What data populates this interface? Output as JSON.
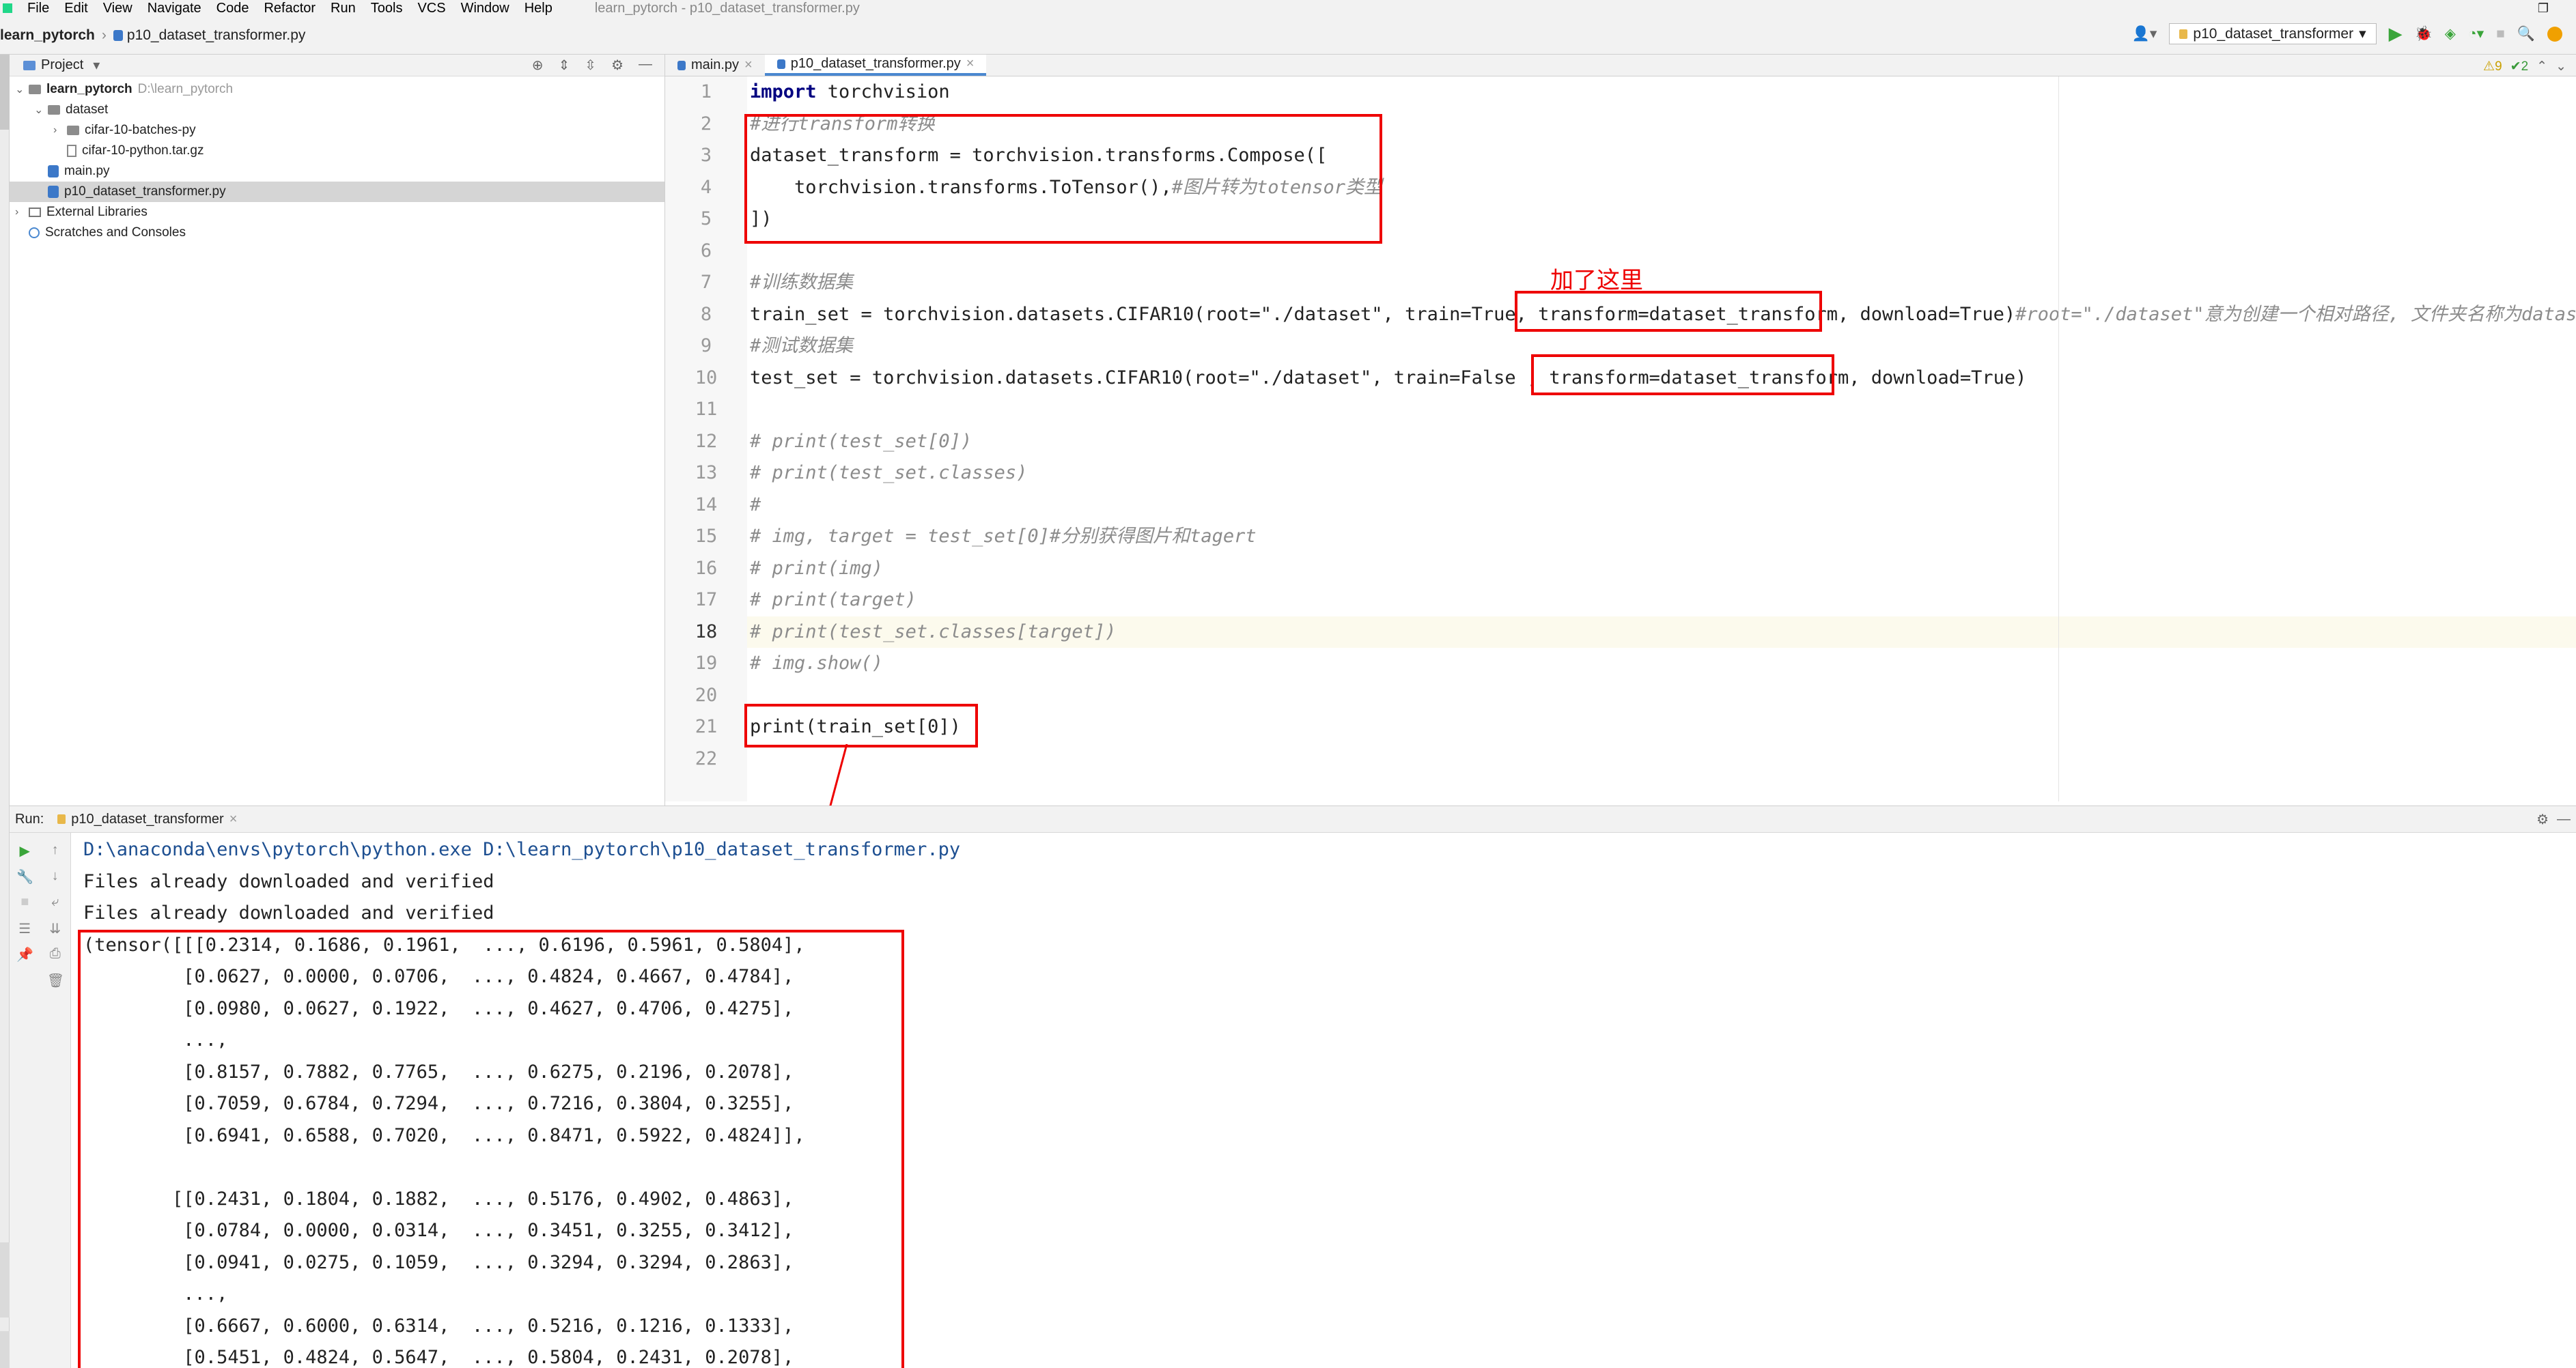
{
  "menubar": {
    "items": [
      "File",
      "Edit",
      "View",
      "Navigate",
      "Code",
      "Refactor",
      "Run",
      "Tools",
      "VCS",
      "Window",
      "Help"
    ],
    "title": "learn_pytorch - p10_dataset_transformer.py"
  },
  "navbar": {
    "project": "learn_pytorch",
    "file": "p10_dataset_transformer.py",
    "run_config": "p10_dataset_transformer",
    "warnings": "⚠9",
    "checks": "✔2"
  },
  "project_panel": {
    "title": "Project",
    "root_name": "learn_pytorch",
    "root_path": "D:\\learn_pytorch",
    "items": [
      {
        "label": "dataset"
      },
      {
        "label": "cifar-10-batches-py"
      },
      {
        "label": "cifar-10-python.tar.gz"
      },
      {
        "label": "main.py"
      },
      {
        "label": "p10_dataset_transformer.py"
      },
      {
        "label": "External Libraries"
      },
      {
        "label": "Scratches and Consoles"
      }
    ]
  },
  "editor": {
    "tabs": [
      {
        "label": "main.py"
      },
      {
        "label": "p10_dataset_transformer.py"
      }
    ],
    "annotation": "加了这里",
    "lines": [
      {
        "n": "1",
        "a": "import",
        "b": " torchvision",
        "c": "",
        "d": "",
        "e": ""
      },
      {
        "n": "2",
        "a": "",
        "b": "",
        "c": "#进行transform转换",
        "d": "",
        "e": ""
      },
      {
        "n": "3",
        "a": "",
        "b": "dataset_transform = torchvision.transforms.Compose([",
        "c": "",
        "d": "",
        "e": ""
      },
      {
        "n": "4",
        "a": "",
        "b": "    torchvision.transforms.ToTensor(),",
        "c": "#图片转为totensor类型",
        "d": "",
        "e": ""
      },
      {
        "n": "5",
        "a": "",
        "b": "])",
        "c": "",
        "d": "",
        "e": ""
      },
      {
        "n": "6",
        "a": "",
        "b": "",
        "c": "",
        "d": "",
        "e": ""
      },
      {
        "n": "7",
        "a": "",
        "b": "",
        "c": "#训练数据集",
        "d": "",
        "e": ""
      },
      {
        "n": "8",
        "a": "",
        "b": "train_set = torchvision.datasets.CIFAR10(root=\"./dataset\", train=True, transform=dataset_transform, download=True)",
        "c": "#root=\"./dataset\"意为创建一个相对路径, 文件夹名称为dataset",
        "d": "",
        "e": ""
      },
      {
        "n": "9",
        "a": "",
        "b": "",
        "c": "#测试数据集",
        "d": "",
        "e": ""
      },
      {
        "n": "10",
        "a": "",
        "b": "test_set = torchvision.datasets.CIFAR10(root=\"./dataset\", train=False , transform=dataset_transform, download=True)",
        "c": "",
        "d": "",
        "e": ""
      },
      {
        "n": "11",
        "a": "",
        "b": "",
        "c": "",
        "d": "",
        "e": ""
      },
      {
        "n": "12",
        "a": "",
        "b": "",
        "c": "# print(test_set[0])",
        "d": "",
        "e": ""
      },
      {
        "n": "13",
        "a": "",
        "b": "",
        "c": "# print(test_set.classes)",
        "d": "",
        "e": ""
      },
      {
        "n": "14",
        "a": "",
        "b": "",
        "c": "#",
        "d": "",
        "e": ""
      },
      {
        "n": "15",
        "a": "",
        "b": "",
        "c": "# img, target = test_set[0]#分别获得图片和tagert",
        "d": "",
        "e": ""
      },
      {
        "n": "16",
        "a": "",
        "b": "",
        "c": "# print(img)",
        "d": "",
        "e": ""
      },
      {
        "n": "17",
        "a": "",
        "b": "",
        "c": "# print(target)",
        "d": "",
        "e": ""
      },
      {
        "n": "18",
        "a": "",
        "b": "",
        "c": "# print(test_set.classes[target])",
        "d": "",
        "e": ""
      },
      {
        "n": "19",
        "a": "",
        "b": "",
        "c": "# img.show()",
        "d": "",
        "e": ""
      },
      {
        "n": "20",
        "a": "",
        "b": "",
        "c": "",
        "d": "",
        "e": ""
      },
      {
        "n": "21",
        "a": "",
        "b": "print(train_set[0])",
        "c": "",
        "d": "",
        "e": ""
      },
      {
        "n": "22",
        "a": "",
        "b": "",
        "c": "",
        "d": "",
        "e": ""
      }
    ]
  },
  "run": {
    "label": "Run:",
    "tab": "p10_dataset_transformer",
    "output": [
      "D:\\anaconda\\envs\\pytorch\\python.exe D:\\learn_pytorch\\p10_dataset_transformer.py",
      "Files already downloaded and verified",
      "Files already downloaded and verified",
      "(tensor([[[0.2314, 0.1686, 0.1961,  ..., 0.6196, 0.5961, 0.5804],",
      "         [0.0627, 0.0000, 0.0706,  ..., 0.4824, 0.4667, 0.4784],",
      "         [0.0980, 0.0627, 0.1922,  ..., 0.4627, 0.4706, 0.4275],",
      "         ...,",
      "         [0.8157, 0.7882, 0.7765,  ..., 0.6275, 0.2196, 0.2078],",
      "         [0.7059, 0.6784, 0.7294,  ..., 0.7216, 0.3804, 0.3255],",
      "         [0.6941, 0.6588, 0.7020,  ..., 0.8471, 0.5922, 0.4824]],",
      "",
      "        [[0.2431, 0.1804, 0.1882,  ..., 0.5176, 0.4902, 0.4863],",
      "         [0.0784, 0.0000, 0.0314,  ..., 0.3451, 0.3255, 0.3412],",
      "         [0.0941, 0.0275, 0.1059,  ..., 0.3294, 0.3294, 0.2863],",
      "         ...,",
      "         [0.6667, 0.6000, 0.6314,  ..., 0.5216, 0.1216, 0.1333],",
      "         [0.5451, 0.4824, 0.5647,  ..., 0.5804, 0.2431, 0.2078],"
    ]
  }
}
